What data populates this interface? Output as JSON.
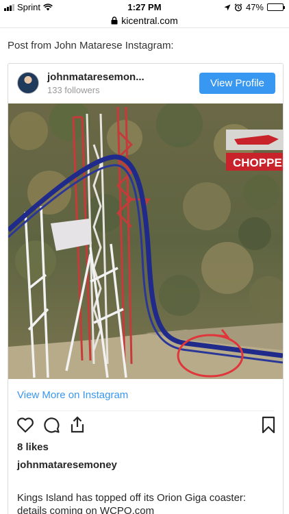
{
  "status_bar": {
    "carrier": "Sprint",
    "time": "1:27 PM",
    "battery": "47%",
    "battery_level": 0.47
  },
  "browser": {
    "url": "kicentral.com"
  },
  "intro": "Post from John Matarese Instagram:",
  "post": {
    "username": "johnmataresemon...",
    "followers": "133 followers",
    "view_profile_label": "View Profile",
    "photo_banner_text": "CHOPPER",
    "view_more_label": "View More on Instagram",
    "likes": "8 likes",
    "owner_username": "johnmataresemoney",
    "caption": "Kings Island has topped off its Orion Giga coaster: details coming on WCPO.com"
  },
  "icons": {
    "heart": "heart-icon",
    "comment": "comment-icon",
    "share": "share-icon",
    "bookmark": "bookmark-icon",
    "lock": "lock-icon",
    "wifi": "wifi-icon",
    "location": "location-icon",
    "alarm": "alarm-icon"
  },
  "colors": {
    "accent": "#3897f0",
    "track": "#1f2a8a",
    "annotation": "#e0353a",
    "banner": "#c8232b"
  }
}
